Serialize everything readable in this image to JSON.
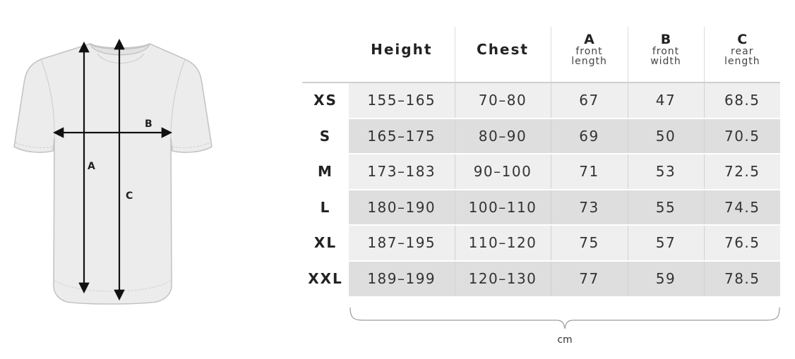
{
  "diagram": {
    "labels": {
      "a": "A",
      "b": "B",
      "c": "C"
    }
  },
  "table": {
    "headers": {
      "height": "Height",
      "chest": "Chest",
      "a": {
        "letter": "A",
        "line1": "front",
        "line2": "length"
      },
      "b": {
        "letter": "B",
        "line1": "front",
        "line2": "width"
      },
      "c": {
        "letter": "C",
        "line1": "rear",
        "line2": "length"
      }
    },
    "rows": [
      {
        "size": "XS",
        "height": "155–165",
        "chest": "70–80",
        "a": "67",
        "b": "47",
        "c": "68.5"
      },
      {
        "size": "S",
        "height": "165–175",
        "chest": "80–90",
        "a": "69",
        "b": "50",
        "c": "70.5"
      },
      {
        "size": "M",
        "height": "173–183",
        "chest": "90–100",
        "a": "71",
        "b": "53",
        "c": "72.5"
      },
      {
        "size": "L",
        "height": "180–190",
        "chest": "100–110",
        "a": "73",
        "b": "55",
        "c": "74.5"
      },
      {
        "size": "XL",
        "height": "187–195",
        "chest": "110–120",
        "a": "75",
        "b": "57",
        "c": "76.5"
      },
      {
        "size": "XXL",
        "height": "189–199",
        "chest": "120–130",
        "a": "77",
        "b": "59",
        "c": "78.5"
      }
    ]
  },
  "unit": "cm",
  "colors": {
    "shirt_fill": "#ececec",
    "shirt_stroke": "#c4c4c4",
    "row_light": "#efefef",
    "row_dark": "#dedede",
    "arrow": "#111111"
  }
}
